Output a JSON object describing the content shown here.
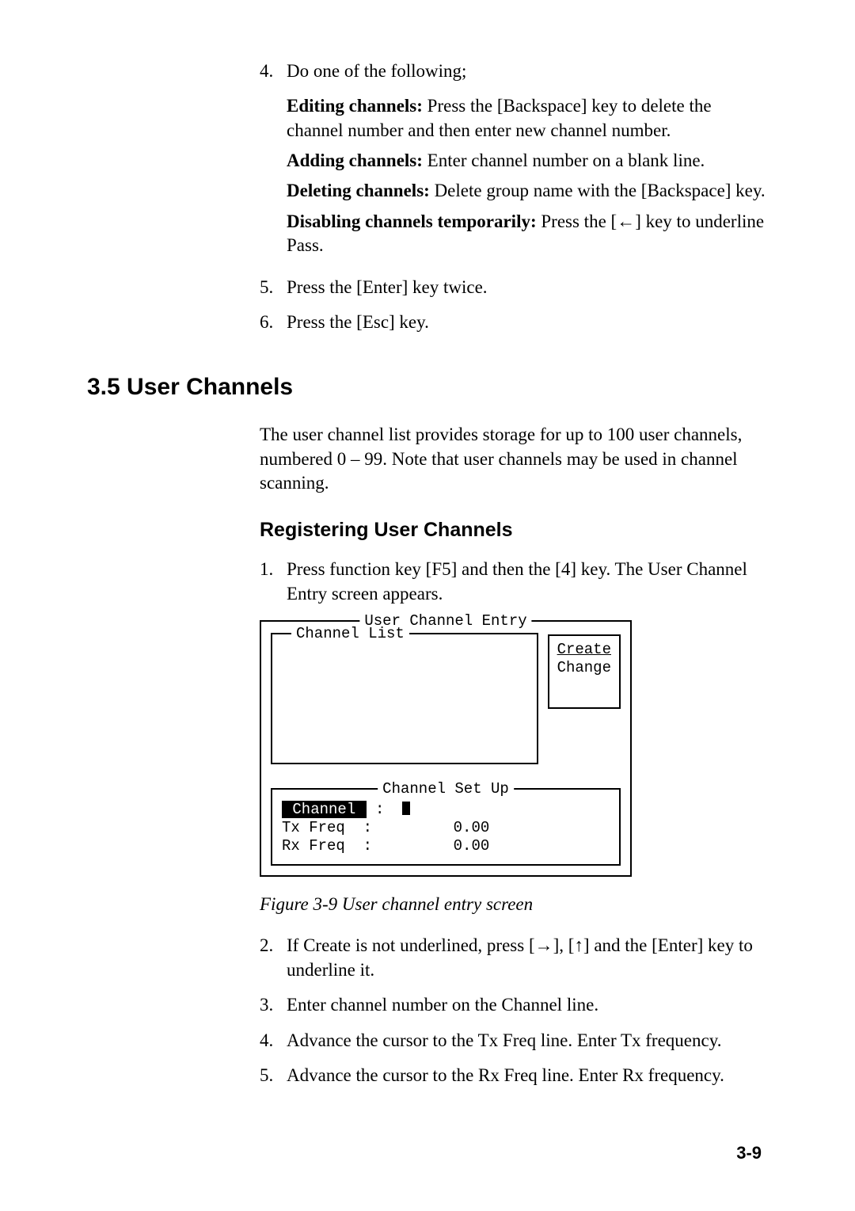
{
  "list4": {
    "num": "4.",
    "text": "Do one of the following;",
    "sub1a": "Editing channels:",
    "sub1b": " Press the [Backspace] key to delete the channel number and then enter new channel number.",
    "sub2a": "Adding channels:",
    "sub2b": " Enter channel number on a blank line.",
    "sub3a": "Deleting channels:",
    "sub3b": " Delete group name with the [Backspace] key.",
    "sub4a": "Disabling channels temporarily:",
    "sub4b": " Press the [←] key to underline Pass."
  },
  "list5": {
    "num": "5.",
    "text": "Press the [Enter] key twice."
  },
  "list6": {
    "num": "6.",
    "text": "Press the [Esc] key."
  },
  "section": "3.5 User Channels",
  "intro": "The user channel list provides storage for up to 100 user channels, numbered 0 – 99. Note that user channels may be used in channel scanning.",
  "subhead": "Registering User Channels",
  "step1": {
    "num": "1.",
    "text": "Press function key [F5] and then the [4] key. The User Channel Entry screen appears."
  },
  "term": {
    "outer_legend": " User Channel Entry ",
    "chlist_legend": " Channel List ",
    "side_create": "Create",
    "side_change": "Change",
    "chset_legend": " Channel Set Up ",
    "channel_label": " Channel ",
    "colon": ":",
    "txfreq": "Tx Freq  :         0.00",
    "rxfreq": "Rx Freq  :         0.00"
  },
  "caption": "Figure 3-9 User channel entry screen",
  "step2": {
    "num": "2.",
    "text": "If Create is not underlined, press [→], [↑] and the [Enter] key to underline it."
  },
  "step3": {
    "num": "3.",
    "text": "Enter channel number on the Channel line."
  },
  "step4": {
    "num": "4.",
    "text": "Advance the cursor to the Tx Freq line. Enter Tx frequency."
  },
  "step5": {
    "num": "5.",
    "text": "Advance the cursor to the Rx Freq line. Enter Rx frequency."
  },
  "pagenum": "3-9"
}
